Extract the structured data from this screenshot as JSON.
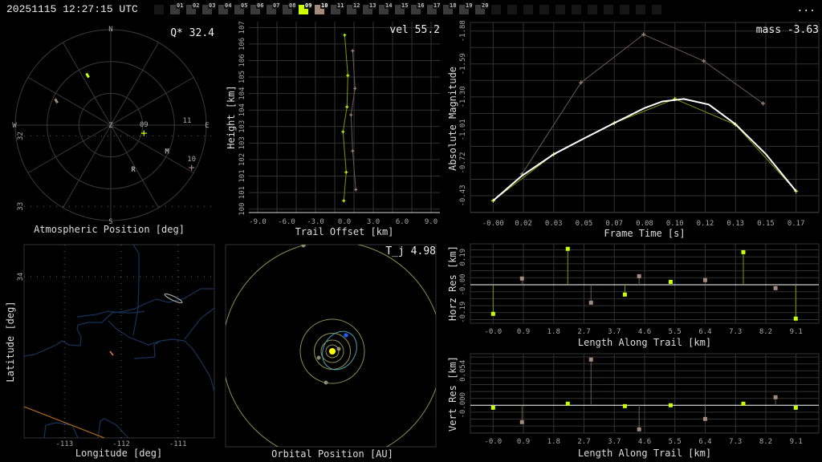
{
  "header": {
    "timestamp": "20251115 12:27:15 UTC",
    "more_label": "...",
    "stations": [
      {
        "label": "",
        "state": "empty"
      },
      {
        "label": "01",
        "state": "inactive"
      },
      {
        "label": "02",
        "state": "inactive"
      },
      {
        "label": "03",
        "state": "inactive"
      },
      {
        "label": "04",
        "state": "inactive"
      },
      {
        "label": "05",
        "state": "inactive"
      },
      {
        "label": "06",
        "state": "inactive"
      },
      {
        "label": "07",
        "state": "inactive"
      },
      {
        "label": "08",
        "state": "inactive"
      },
      {
        "label": "09",
        "state": "active_a"
      },
      {
        "label": "10",
        "state": "active_b"
      },
      {
        "label": "11",
        "state": "inactive"
      },
      {
        "label": "12",
        "state": "inactive"
      },
      {
        "label": "13",
        "state": "inactive"
      },
      {
        "label": "14",
        "state": "inactive"
      },
      {
        "label": "15",
        "state": "inactive"
      },
      {
        "label": "16",
        "state": "inactive"
      },
      {
        "label": "17",
        "state": "inactive"
      },
      {
        "label": "18",
        "state": "inactive"
      },
      {
        "label": "19",
        "state": "inactive"
      },
      {
        "label": "20",
        "state": "inactive"
      },
      {
        "label": "",
        "state": "empty"
      },
      {
        "label": "",
        "state": "empty"
      },
      {
        "label": "",
        "state": "empty"
      },
      {
        "label": "",
        "state": "empty"
      },
      {
        "label": "",
        "state": "empty"
      },
      {
        "label": "",
        "state": "empty"
      },
      {
        "label": "",
        "state": "empty"
      },
      {
        "label": "",
        "state": "empty"
      },
      {
        "label": "",
        "state": "empty"
      },
      {
        "label": "",
        "state": "empty"
      },
      {
        "label": "",
        "state": "empty"
      }
    ]
  },
  "colors": {
    "station_a": "#ccff00",
    "station_b": "#a38a7a",
    "station_a_line": "#7a9900",
    "station_b_line": "#6e5a50",
    "fit": "#ffffff",
    "grid": "#333333",
    "river": "#17325a",
    "border": "#b06a1a",
    "trail": "#ff7a30",
    "orbit": "#8c8c50",
    "planet": "#8a8a78",
    "meteoroid_orbit": "#4aa0b0",
    "earth": "#1a5cff",
    "sun": "#ffff00"
  },
  "chart_data": [
    {
      "type": "polar",
      "title": "Atmospheric Position [deg]",
      "annotation": "Q* 32.4",
      "compass": {
        "n": "N",
        "e": "E",
        "s": "S",
        "w": "W",
        "z": "Z"
      },
      "rings_zenith_deg": [
        30,
        60,
        90
      ],
      "series": [
        {
          "station": "09",
          "points": [
            {
              "az": 335,
              "zenith": 51.7
            }
          ]
        },
        {
          "station": "10",
          "points": [
            {
              "az": 294,
              "zenith": 56.2
            }
          ]
        }
      ],
      "markers": [
        {
          "label": "M",
          "az": 115,
          "zenith": 58.5
        },
        {
          "label": "R",
          "az": 153,
          "zenith": 46.7
        }
      ]
    },
    {
      "type": "line",
      "annotation": "vel 55.2",
      "xlabel": "Trail Offset [km]",
      "ylabel": "Height [km]",
      "xlim": [
        -9,
        9
      ],
      "ylim": [
        100,
        107
      ],
      "xticks": [
        "-9.0",
        "-6.0",
        "-3.0",
        "0.0",
        "3.0",
        "6.0",
        "9.0"
      ],
      "yticks": [
        "100",
        "101",
        "101",
        "102",
        "103",
        "103",
        "104",
        "104",
        "105",
        "106",
        "106",
        "107"
      ],
      "series": [
        {
          "station": "09",
          "x": [
            0.03,
            0.36,
            0.27,
            -0.14,
            0.19,
            -0.06
          ],
          "y": [
            106.71,
            105.15,
            103.94,
            102.98,
            101.42,
            100.32
          ]
        },
        {
          "station": "10",
          "x": [
            0.86,
            1.11,
            0.69,
            0.86,
            1.19
          ],
          "y": [
            106.1,
            104.65,
            103.63,
            102.24,
            100.75
          ]
        }
      ]
    },
    {
      "type": "line",
      "annotation": "mass -3.63",
      "xlabel": "Frame Time [s]",
      "ylabel": "Absolute Magnitude",
      "xlim": [
        0,
        0.17
      ],
      "ylim": [
        -0.43,
        -1.88
      ],
      "xticks": [
        "-0.00",
        "0.02",
        "0.03",
        "0.05",
        "0.07",
        "0.08",
        "0.10",
        "0.12",
        "0.13",
        "0.15",
        "0.17"
      ],
      "yticks": [
        "-1.88",
        "-1.59",
        "-1.30",
        "-1.01",
        "-0.72",
        "-0.43"
      ],
      "series": [
        {
          "station": "09",
          "x": [
            0,
            0.034,
            0.068,
            0.102,
            0.136,
            0.17
          ],
          "y": [
            -0.386,
            -0.795,
            -1.07,
            -1.282,
            -1.056,
            -0.47
          ]
        },
        {
          "station": "10",
          "x": [
            0.0162,
            0.0493,
            0.0844,
            0.1182,
            0.1515
          ],
          "y": [
            -0.621,
            -1.426,
            -1.85,
            -1.616,
            -1.242
          ]
        },
        {
          "station": "fit",
          "x": [
            0,
            0.016,
            0.034,
            0.05,
            0.068,
            0.085,
            0.095,
            0.107,
            0.121,
            0.136,
            0.153,
            0.17
          ],
          "y": [
            -0.386,
            -0.604,
            -0.795,
            -0.926,
            -1.07,
            -1.202,
            -1.26,
            -1.282,
            -1.233,
            -1.06,
            -0.797,
            -0.47
          ]
        }
      ]
    },
    {
      "type": "map",
      "xlabel": "Longitude [deg]",
      "ylabel": "Latitude [deg]",
      "xticks": [
        "-113",
        "-112",
        "-111"
      ],
      "yticks": [
        "34",
        "33",
        "32"
      ],
      "stations": [
        {
          "label": "09",
          "lon": -111.6,
          "lat": 31.96,
          "marker": true
        },
        {
          "label": "10",
          "lon": -110.76,
          "lat": 32.45,
          "marker": true
        },
        {
          "label": "11",
          "lon": -110.84,
          "lat": 31.81,
          "marker": false
        }
      ]
    },
    {
      "type": "orbit",
      "title": "Orbital Position [AU]",
      "annotation": "T_j 4.98"
    },
    {
      "type": "scatter",
      "xlabel": "Length Along Trail [km]",
      "ylabel": "Horz Res [km]",
      "xlim": [
        0,
        9.13
      ],
      "xticks": [
        "-0.0",
        "0.9",
        "1.8",
        "2.7",
        "3.7",
        "4.6",
        "5.5",
        "6.4",
        "7.3",
        "8.2",
        "9.1"
      ],
      "yticks": [
        {
          "label": "0.19",
          "value": 0.19
        },
        {
          "label": "-0.00",
          "value": 0.0
        },
        {
          "label": "-0.19",
          "value": -0.19
        }
      ],
      "series": [
        {
          "station": "09",
          "x": [
            0,
            2.25,
            3.97,
            5.35,
            7.54,
            9.12
          ],
          "y": [
            -0.201,
            0.248,
            -0.068,
            0.02,
            0.225,
            -0.234
          ]
        },
        {
          "station": "10",
          "x": [
            0.87,
            2.95,
            4.4,
            6.39,
            8.51
          ],
          "y": [
            0.043,
            -0.124,
            0.059,
            0.032,
            -0.024
          ]
        }
      ]
    },
    {
      "type": "scatter",
      "xlabel": "Length Along Trail [km]",
      "ylabel": "Vert Res [km]",
      "xlim": [
        0,
        9.13
      ],
      "xticks": [
        "-0.0",
        "0.9",
        "1.8",
        "2.7",
        "3.7",
        "4.6",
        "5.5",
        "6.4",
        "7.3",
        "8.2",
        "9.1"
      ],
      "yticks": [
        {
          "label": "0.054",
          "value": 0.054
        },
        {
          "label": "-0.000",
          "value": 0.0
        }
      ],
      "series": [
        {
          "station": "09",
          "x": [
            0,
            2.25,
            3.97,
            5.35,
            7.54,
            9.12
          ],
          "y": [
            -0.0038,
            0.0025,
            -0.0013,
            0.0,
            0.0025,
            -0.0038
          ]
        },
        {
          "station": "10",
          "x": [
            0.87,
            2.95,
            4.4,
            6.39,
            8.51
          ],
          "y": [
            -0.0264,
            0.0716,
            -0.0377,
            -0.0214,
            0.0126
          ]
        }
      ]
    }
  ]
}
